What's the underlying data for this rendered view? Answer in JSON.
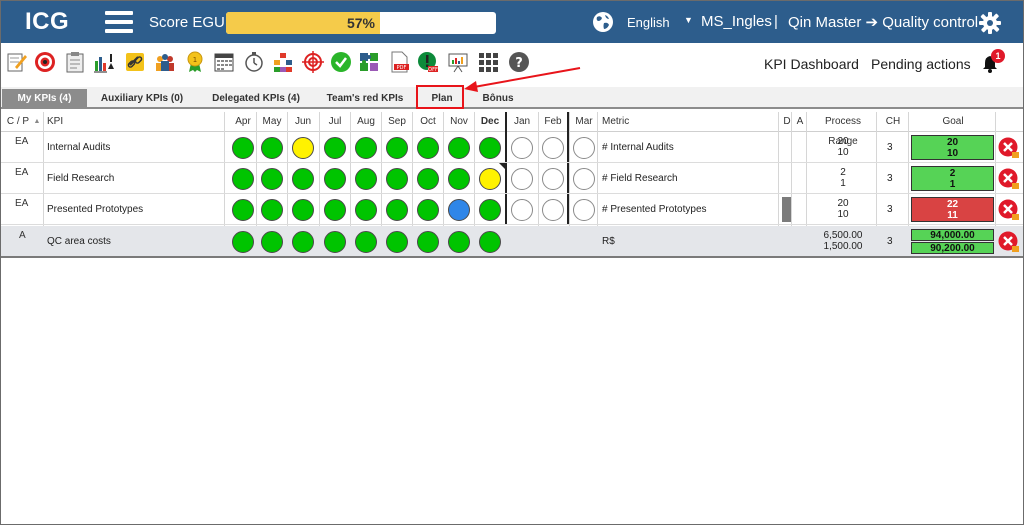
{
  "app": {
    "logo": "ICG"
  },
  "header": {
    "score_label": "Score EGU:",
    "score_value": 57,
    "score_text": "57%",
    "language": "English",
    "user": "MS_Ingles",
    "separator": "|",
    "breadcrumb": "Qin Master ➔ Quality control"
  },
  "toolbar": {
    "icons": [
      "edit-icon",
      "target-icon",
      "clipboard-icon",
      "chart-download-icon",
      "link-icon",
      "team-icon",
      "award-icon",
      "calendar-icon",
      "stopwatch-icon",
      "hierarchy-icon",
      "crosshair-icon",
      "check-circle-icon",
      "puzzle-icon",
      "pdf-icon",
      "alert-off-icon",
      "presentation-icon",
      "grid-icon",
      "help-icon"
    ],
    "kpi_dashboard": "KPI Dashboard",
    "pending_actions": "Pending actions",
    "notification_count": "1"
  },
  "tabs": [
    {
      "label": "My KPIs (4)",
      "active": true
    },
    {
      "label": "Auxiliary KPIs (0)",
      "active": false
    },
    {
      "label": "Delegated KPIs (4)",
      "active": false
    },
    {
      "label": "Team's red KPIs",
      "active": false
    },
    {
      "label": "Plan",
      "active": false,
      "highlighted": true
    },
    {
      "label": "Bônus",
      "active": false
    }
  ],
  "columns": {
    "cp": "C / P",
    "sort": "▲",
    "kpi": "KPI",
    "months": [
      "Apr",
      "May",
      "Jun",
      "Jul",
      "Aug",
      "Sep",
      "Oct",
      "Nov",
      "Dec",
      "Jan",
      "Feb",
      "Mar"
    ],
    "current_month": "Dec",
    "metric": "Metric",
    "d": "D",
    "a": "A",
    "process_range": "Process Range",
    "ch": "CH",
    "goal": "Goal"
  },
  "colors": {
    "green": "#00c400",
    "yellow": "#fff200",
    "blue": "#2f86e8",
    "empty": "#ffffff",
    "goal_green": "#56d356",
    "goal_red": "#d94343"
  },
  "rows": [
    {
      "cp": "EA",
      "kpi": "Internal Audits",
      "status": [
        "green",
        "green",
        "yellow",
        "green",
        "green",
        "green",
        "green",
        "green",
        "green",
        "empty",
        "empty",
        "empty"
      ],
      "metric": "# Internal Audits",
      "range_top": "20",
      "range_bottom": "10",
      "ch": "3",
      "goal_top": "20",
      "goal_bottom": "10",
      "goal_color": "green",
      "d_bar": false
    },
    {
      "cp": "EA",
      "kpi": "Field Research",
      "status": [
        "green",
        "green",
        "green",
        "green",
        "green",
        "green",
        "green",
        "green",
        "yellow",
        "empty",
        "empty",
        "empty"
      ],
      "metric": "# Field Research",
      "range_top": "2",
      "range_bottom": "1",
      "ch": "3",
      "goal_top": "2",
      "goal_bottom": "1",
      "goal_color": "green",
      "d_bar": false
    },
    {
      "cp": "EA",
      "kpi": "Presented Prototypes",
      "status": [
        "green",
        "green",
        "green",
        "green",
        "green",
        "green",
        "green",
        "blue",
        "green",
        "empty",
        "empty",
        "empty"
      ],
      "metric": "# Presented Prototypes",
      "range_top": "20",
      "range_bottom": "10",
      "ch": "3",
      "goal_top": "22",
      "goal_bottom": "11",
      "goal_color": "red",
      "d_bar": true
    },
    {
      "cp": "A",
      "kpi": "QC area costs",
      "status": [
        "green",
        "green",
        "green",
        "green",
        "green",
        "green",
        "green",
        "green",
        "green"
      ],
      "metric": "R$",
      "range_top": "6,500.00",
      "range_bottom": "1,500.00",
      "ch": "3",
      "goal_top": "94,000.00",
      "goal_bottom": "90,200.00",
      "goal_color": "green",
      "d_bar": false,
      "split_goal": true
    }
  ]
}
